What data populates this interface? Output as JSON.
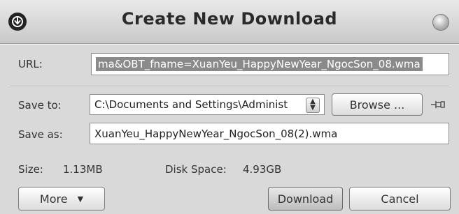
{
  "window": {
    "title": "Create New Download"
  },
  "url": {
    "label": "URL:",
    "value": "ma&OBT_fname=XuanYeu_HappyNewYear_NgocSon_08.wma"
  },
  "save_to": {
    "label": "Save to:",
    "value": "C:\\Documents and Settings\\Administ",
    "browse_label": "Browse ..."
  },
  "save_as": {
    "label": "Save as:",
    "value": "XuanYeu_HappyNewYear_NgocSon_08(2).wma"
  },
  "info": {
    "size_label": "Size:",
    "size_value": "1.13MB",
    "disk_label": "Disk Space:",
    "disk_value": "4.93GB"
  },
  "buttons": {
    "more": "More",
    "download": "Download",
    "cancel": "Cancel"
  }
}
